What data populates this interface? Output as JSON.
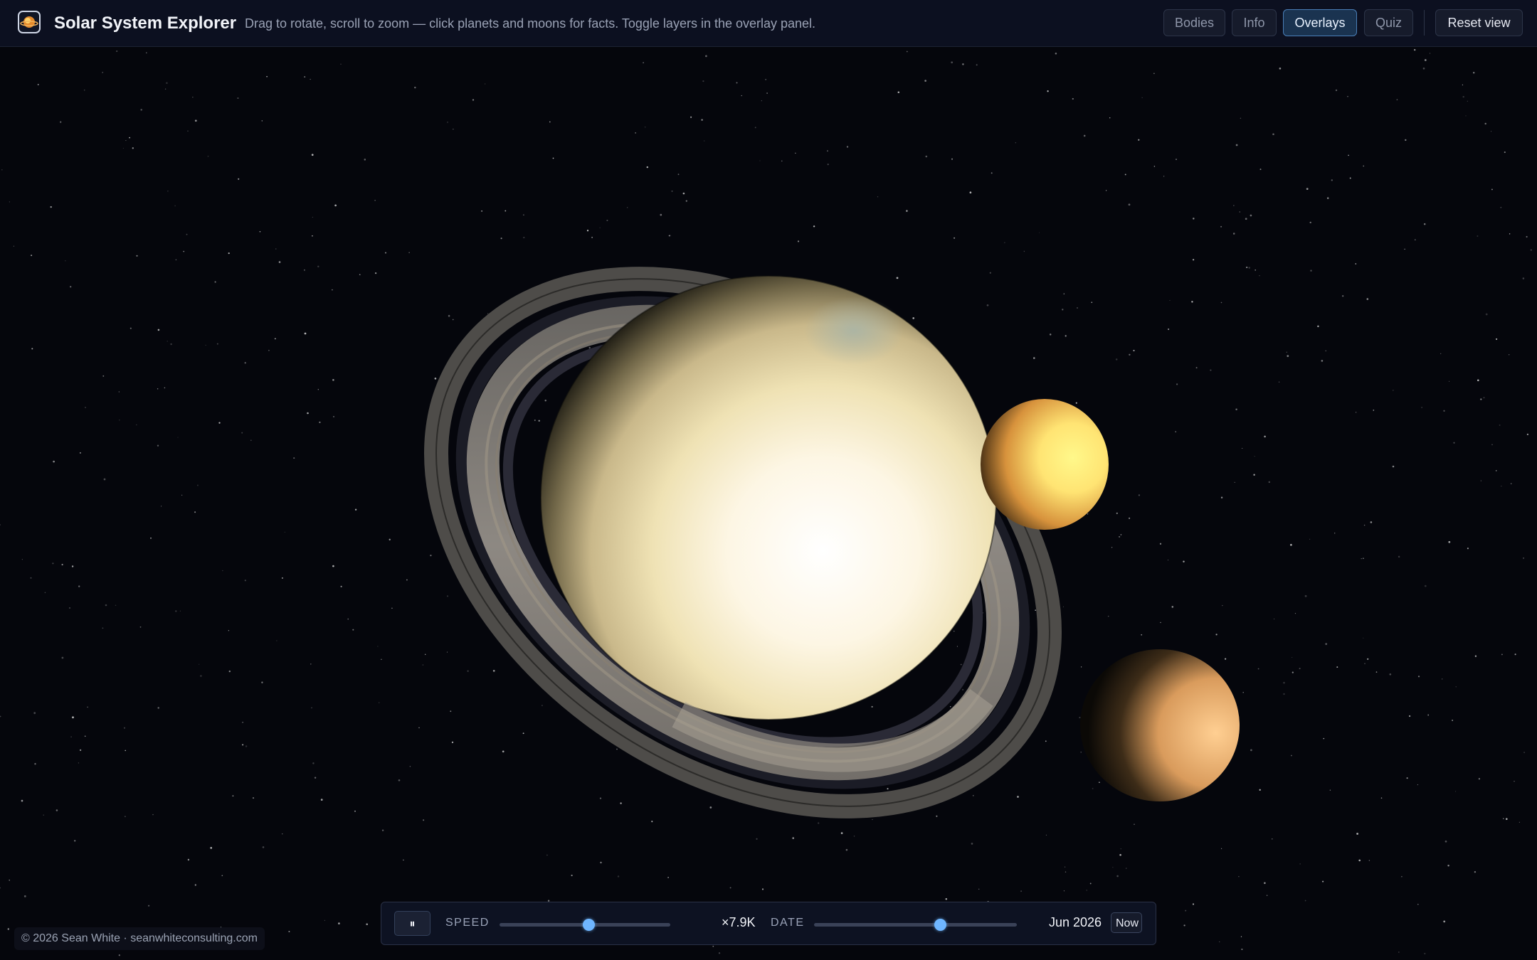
{
  "header": {
    "title": "Solar System Explorer",
    "instructions": "Drag to rotate, scroll to zoom — click planets and moons for facts. Toggle layers in the overlay panel.",
    "nav": [
      "Bodies",
      "Info",
      "Overlays",
      "Quiz"
    ],
    "active_nav": "Overlays",
    "reset_label": "Reset view"
  },
  "controls": {
    "pause_label": "⏸",
    "speed_label": "SPEED",
    "speed_slider_value": 0.52,
    "speed_value": "×7.9K",
    "date_label": "DATE",
    "date_slider_value": 0.62,
    "date_value": "Jun 2026",
    "now_label": "Now"
  },
  "footer": {
    "copyright": "© 2026 Sean White · seanwhiteconsulting.com"
  },
  "colors": {
    "accent": "#6fb6ff",
    "active_tab": "#1a3350",
    "background": "#05060c"
  },
  "scene": {
    "bodies": [
      "saturn-planet",
      "saturn-rings",
      "moon-yellow",
      "moon-orange"
    ]
  }
}
